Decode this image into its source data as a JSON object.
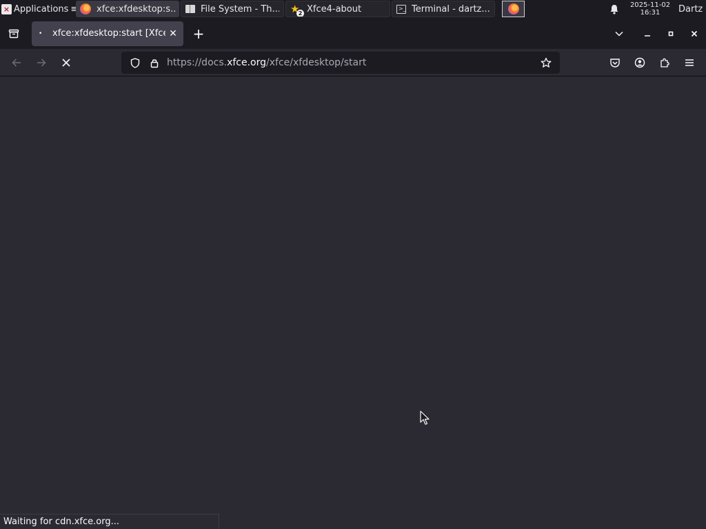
{
  "panel": {
    "applications_label": "Applications",
    "applications_suffix": "≡",
    "tasks": [
      {
        "label": "xfce:xfdesktop:s...",
        "icon": "firefox-icon",
        "active": true
      },
      {
        "label": "File System - Th...",
        "icon": "file-manager-icon",
        "active": false
      },
      {
        "label": "Xfce4-about",
        "icon": "star-icon",
        "badge": "2",
        "active": false
      },
      {
        "label": "Terminal - dartz...",
        "icon": "terminal-icon",
        "active": false
      }
    ],
    "clock_date": "2025-11-02",
    "clock_time": "16:31",
    "user": "Dartz"
  },
  "browser": {
    "tab_title": "xfce:xfdesktop:start [Xfce",
    "url_prefix": "https://docs.",
    "url_host": "xfce.org",
    "url_path": "/xfce/xfdesktop/start",
    "status_text": "Waiting for cdn.xfce.org..."
  },
  "colors": {
    "panel_bg": "#1c1b22",
    "toolbar_bg": "#2b2a33",
    "tab_active_bg": "#42414d",
    "text": "#fbfbfe"
  }
}
